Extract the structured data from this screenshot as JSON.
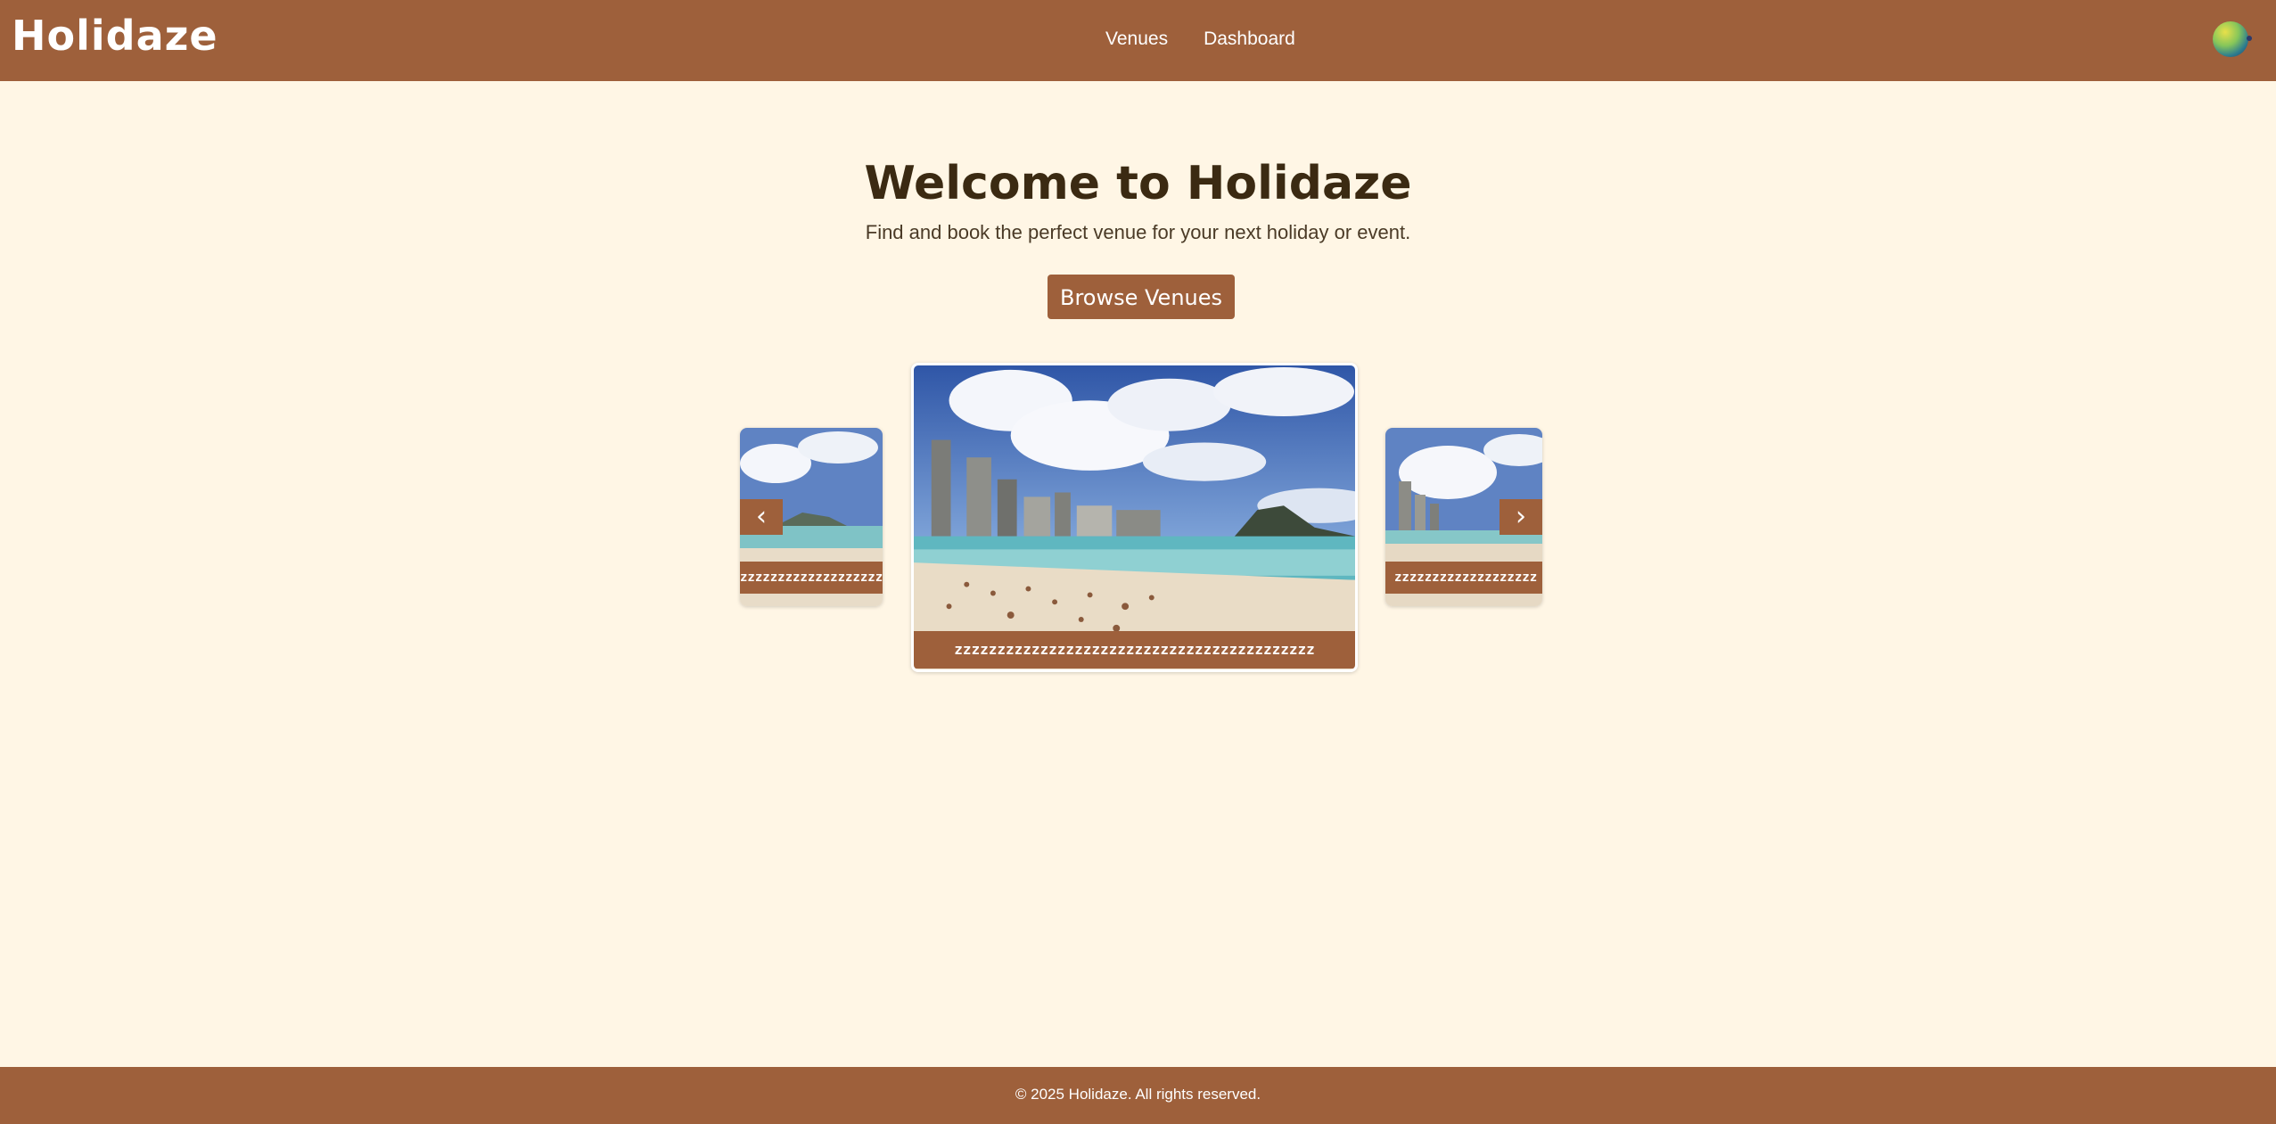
{
  "header": {
    "logo": "Holidaze",
    "nav": {
      "venues": "Venues",
      "dashboard": "Dashboard"
    }
  },
  "hero": {
    "title": "Welcome to Holidaze",
    "subtitle": "Find and book the perfect venue for your next holiday or event.",
    "cta": "Browse Venues"
  },
  "carousel": {
    "prev_icon": "chevron-left-icon",
    "next_icon": "chevron-right-icon",
    "prev_glyph": "‹",
    "next_glyph": "›",
    "main_caption": "zzzzzzzzzzzzzzzzzzzzzzzzzzzzzzzzzzzzzzzzzz",
    "left_caption": "zzzzzzzzzzzzzzzzzzzz",
    "right_caption": "zzzzzzzzzzzzzzzzzzz"
  },
  "footer": {
    "copyright": "© 2025 Holidaze. All rights reserved."
  },
  "colors": {
    "brand": "#9e603b",
    "background": "#fff6e5",
    "heading": "#3b2a12"
  }
}
